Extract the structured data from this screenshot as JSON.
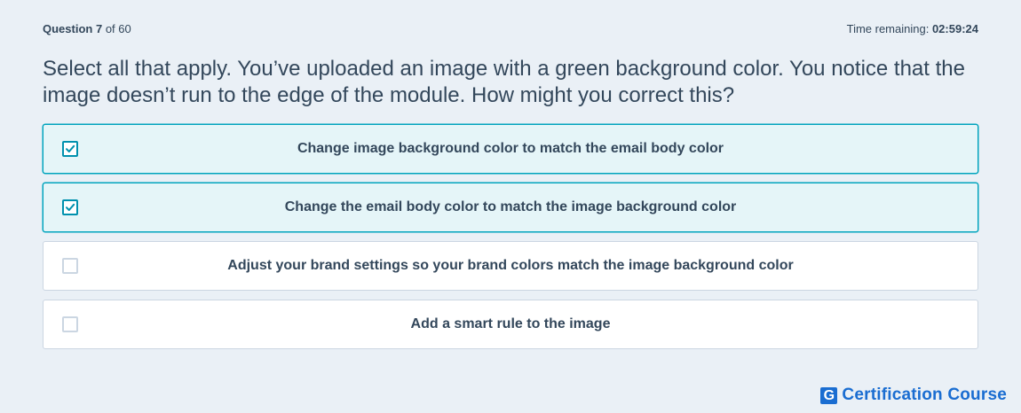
{
  "header": {
    "question_prefix": "Question",
    "question_number": "7",
    "question_of": "of 60",
    "time_label": "Time remaining:",
    "time_value": "02:59:24"
  },
  "question": {
    "text": "Select all that apply. You’ve uploaded an image with a green background color. You notice that the image doesn’t run to the edge of the module. How might you correct this?"
  },
  "options": [
    {
      "label": "Change image background color to match the email body color",
      "checked": true
    },
    {
      "label": "Change the email body color to match the image background color",
      "checked": true
    },
    {
      "label": "Adjust your brand settings so your brand colors match the image background color",
      "checked": false
    },
    {
      "label": "Add a smart rule to the image",
      "checked": false
    }
  ],
  "brand": {
    "mark": "G",
    "text": "Certification Course"
  },
  "colors": {
    "background": "#eaf0f6",
    "text": "#33475b",
    "selected_border": "#00a4bd",
    "selected_fill": "#e5f5f8",
    "check": "#0091ae",
    "brand": "#1a6dd1"
  }
}
